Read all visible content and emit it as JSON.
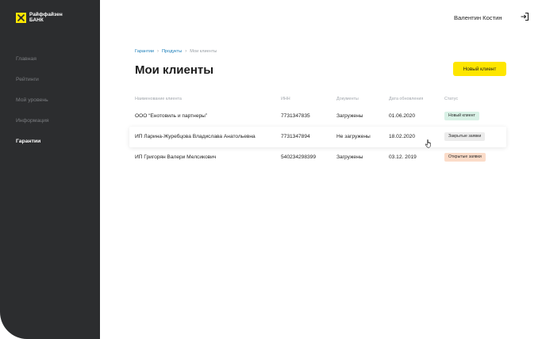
{
  "brand": {
    "line1": "Райффайзен",
    "line2": "БАНК",
    "accent": "#fee600"
  },
  "sidebar": {
    "items": [
      {
        "label": "Главная"
      },
      {
        "label": "Рейтинги"
      },
      {
        "label": "Мой уровень"
      },
      {
        "label": "Информация"
      },
      {
        "label": "Гарантии",
        "active": true
      }
    ]
  },
  "header": {
    "user_name": "Валентин Костин",
    "logout_icon": "logout-icon"
  },
  "breadcrumb": [
    "Гарантии",
    "Продукты",
    "Мои клиенты"
  ],
  "page": {
    "title": "Мои клиенты",
    "new_client_label": "Новый клиент"
  },
  "table": {
    "columns": [
      "Наименование клиента",
      "ИНН",
      "Документы",
      "Дата обновления",
      "Статус"
    ],
    "rows": [
      {
        "name": "ООО “Енотовиль и партнеры”",
        "inn": "7731347835",
        "docs": "Загружены",
        "date": "01.06.2020",
        "status": "Новый клиент",
        "status_color": "#d9f1e6"
      },
      {
        "name": "ИП Ларина-Журебцова Владислава Анатольевна",
        "inn": "7731347894",
        "docs": "Не загружены",
        "date": "18.02.2020",
        "status": "Закрытые заявки",
        "status_color": "#ececec"
      },
      {
        "name": "ИП Григорян Валери Мелсикович",
        "inn": "540234298399",
        "docs": "Загружены",
        "date": "03.12. 2019",
        "status": "Открытые заявки",
        "status_color": "#fbdcc9"
      }
    ]
  }
}
